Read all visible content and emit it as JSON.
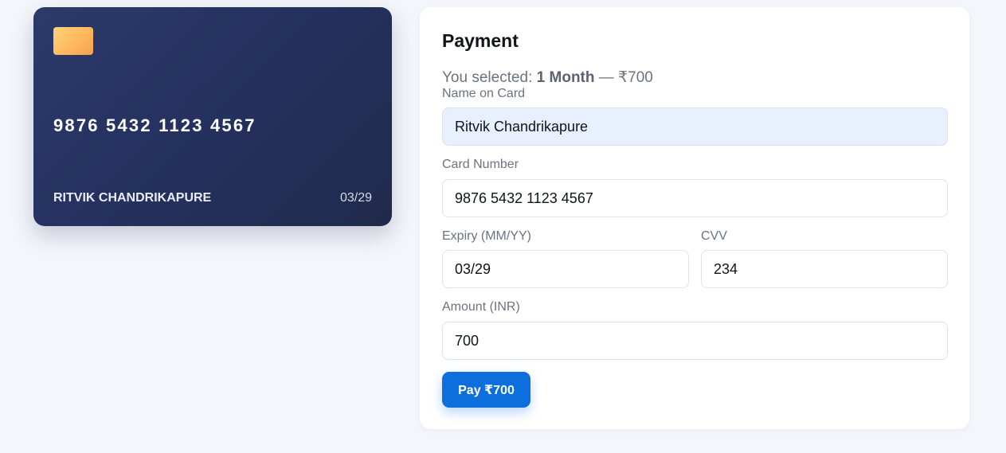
{
  "card_preview": {
    "number": "9876 5432 1123 4567",
    "holder": "RITVIK CHANDRIKAPURE",
    "expiry": "03/29",
    "chip_icon": "card-chip-icon"
  },
  "payment": {
    "title": "Payment",
    "selected_prefix": "You selected: ",
    "selected_plan": "1 Month",
    "selected_price": " — ₹700",
    "fields": {
      "name": {
        "label": "Name on Card",
        "value": "Ritvik Chandrikapure"
      },
      "number": {
        "label": "Card Number",
        "value": "9876 5432 1123 4567"
      },
      "expiry": {
        "label": "Expiry (MM/YY)",
        "value": "03/29"
      },
      "cvv": {
        "label": "CVV",
        "value": "234"
      },
      "amount": {
        "label": "Amount (INR)",
        "value": "700"
      }
    },
    "pay_button_label": "Pay ₹700"
  },
  "colors": {
    "page_background": "#f4f6fb",
    "card_gradient_start": "#2c3a6a",
    "card_gradient_end": "#1f2a4c",
    "chip": "#ffc46b",
    "accent_button": "#0c6fdd",
    "autofill_background": "#e8f0fe"
  }
}
